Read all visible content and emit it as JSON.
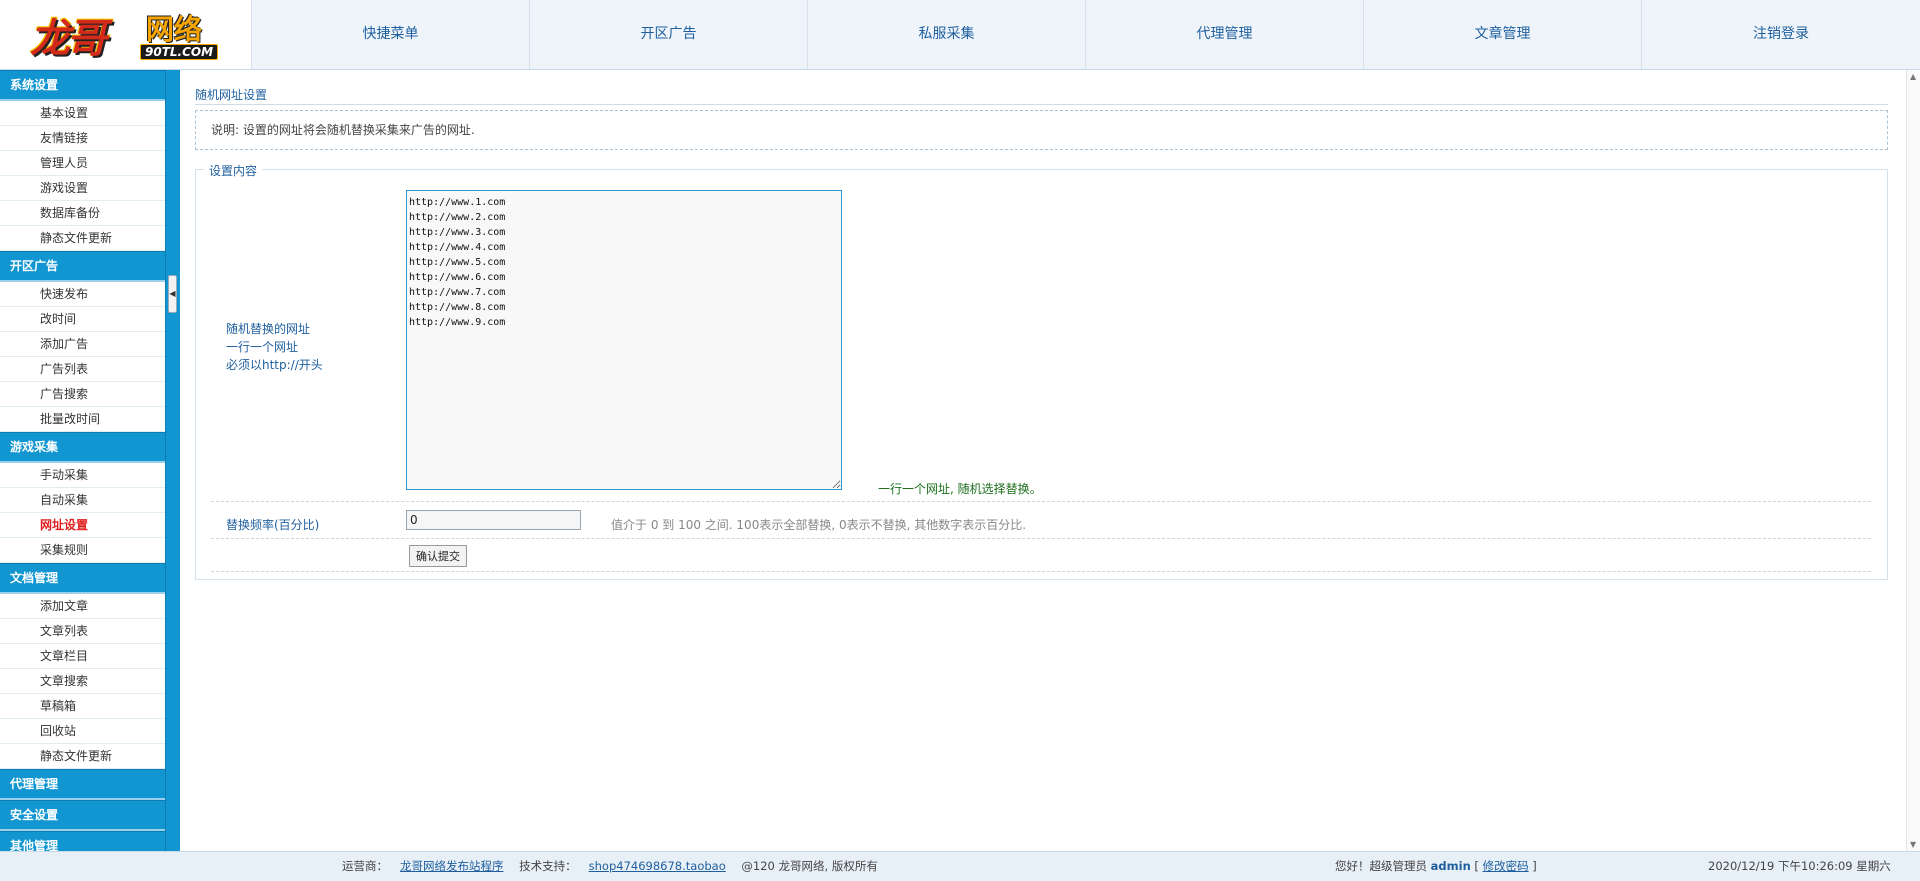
{
  "logo": {
    "main": "龙哥",
    "sub": "网络",
    "url": "90TL.COM"
  },
  "topnav": [
    "快捷菜单",
    "开区广告",
    "私服采集",
    "代理管理",
    "文章管理",
    "注销登录"
  ],
  "sidebar": {
    "groups": [
      {
        "title": "系统设置",
        "items": [
          "基本设置",
          "友情链接",
          "管理人员",
          "游戏设置",
          "数据库备份",
          "静态文件更新"
        ]
      },
      {
        "title": "开区广告",
        "items": [
          "快速发布",
          "改时间",
          "添加广告",
          "广告列表",
          "广告搜索",
          "批量改时间"
        ]
      },
      {
        "title": "游戏采集",
        "items": [
          "手动采集",
          "自动采集",
          "网址设置",
          "采集规则"
        ]
      },
      {
        "title": "文档管理",
        "items": [
          "添加文章",
          "文章列表",
          "文章栏目",
          "文章搜索",
          "草稿箱",
          "回收站",
          "静态文件更新"
        ]
      },
      {
        "title": "代理管理",
        "items": []
      },
      {
        "title": "安全设置",
        "items": []
      },
      {
        "title": "其他管理",
        "items": []
      }
    ],
    "active_item": "网址设置"
  },
  "main": {
    "title": "随机网址设置",
    "note": "说明: 设置的网址将会随机替换采集来广告的网址.",
    "fieldset_legend": "设置内容",
    "url_label": [
      "随机替换的网址",
      "一行一个网址",
      "必须以http://开头"
    ],
    "urls": "http://www.1.com\nhttp://www.2.com\nhttp://www.3.com\nhttp://www.4.com\nhttp://www.5.com\nhttp://www.6.com\nhttp://www.7.com\nhttp://www.8.com\nhttp://www.9.com",
    "url_hint": "一行一个网址, 随机选择替换。",
    "freq_label": "替换频率(百分比)",
    "freq_value": "0",
    "freq_hint": "值介于 0 到 100 之间. 100表示全部替换, 0表示不替换, 其他数字表示百分比.",
    "submit_label": "确认提交"
  },
  "footer": {
    "operator_label": "运营商：",
    "operator_link": "龙哥网络发布站程序",
    "support_label": "技术支持：",
    "support_link": "shop474698678.taobao",
    "copyright": "@120 龙哥网络, 版权所有",
    "greeting": "您好！超级管理员 ",
    "admin_name": "admin",
    "bracket_open": " [ ",
    "change_pwd": "修改密码",
    "bracket_close": " ]",
    "datetime": "2020/12/19 下午10:26:09 星期六"
  },
  "colors": {
    "sidebar_header": "#1296d1",
    "link_blue": "#1f5f9e",
    "active_red": "#e02020",
    "hint_green": "#1d6f1d",
    "topbar_bg": "#eef4fa"
  }
}
